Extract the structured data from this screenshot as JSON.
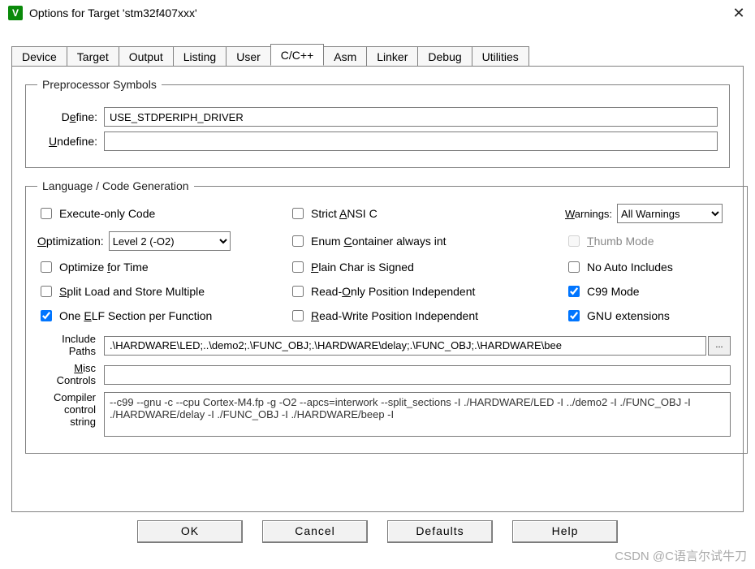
{
  "window": {
    "title": "Options for Target 'stm32f407xxx'",
    "close": "✕",
    "icon_letter": "V"
  },
  "tabs": {
    "items": [
      "Device",
      "Target",
      "Output",
      "Listing",
      "User",
      "C/C++",
      "Asm",
      "Linker",
      "Debug",
      "Utilities"
    ],
    "active": "C/C++"
  },
  "preproc": {
    "legend": "Preprocessor Symbols",
    "define_label_pre": "D",
    "define_label_u": "e",
    "define_label_post": "fine:",
    "define_value": "USE_STDPERIPH_DRIVER",
    "undef_label_pre": "",
    "undef_label_u": "U",
    "undef_label_post": "ndefine:",
    "undef_value": ""
  },
  "lang": {
    "legend": "Language / Code Generation",
    "execute_only": "Execute-only Code",
    "strict_ansi_pre": "Strict ",
    "strict_ansi_u": "A",
    "strict_ansi_post": "NSI C",
    "warnings_pre": "",
    "warnings_u": "W",
    "warnings_post": "arnings:",
    "warnings_value": "All Warnings",
    "optimization_pre": "",
    "optimization_u": "O",
    "optimization_post": "ptimization:",
    "optimization_value": "Level 2 (-O2)",
    "enum_pre": "Enum ",
    "enum_u": "C",
    "enum_post": "ontainer always int",
    "thumb_pre": "",
    "thumb_u": "T",
    "thumb_post": "humb Mode",
    "opt_time_pre": "Optimize ",
    "opt_time_u": "f",
    "opt_time_post": "or Time",
    "plain_pre": "",
    "plain_u": "P",
    "plain_post": "lain Char is Signed",
    "noauto": "No Auto Includes",
    "split_pre": "",
    "split_u": "S",
    "split_post": "plit Load and Store Multiple",
    "ropi_pre": "Read-",
    "ropi_u": "O",
    "ropi_post": "nly Position Independent",
    "c99": "C99 Mode",
    "oneelf_pre": "One ",
    "oneelf_u": "E",
    "oneelf_post": "LF Section per Function",
    "rwpi_pre": "",
    "rwpi_u": "R",
    "rwpi_post": "ead-Write Position Independent",
    "gnu": "GNU extensions",
    "include_label": "Include\nPaths",
    "include_value": ".\\HARDWARE\\LED;..\\demo2;.\\FUNC_OBJ;.\\HARDWARE\\delay;.\\FUNC_OBJ;.\\HARDWARE\\bee",
    "browse": "...",
    "misc_label_pre": "",
    "misc_label_u": "M",
    "misc_label_post": "isc\nControls",
    "misc_value": "",
    "ccs_label": "Compiler\ncontrol\nstring",
    "ccs_value": "--c99 --gnu -c --cpu Cortex-M4.fp -g -O2 --apcs=interwork --split_sections -I ./HARDWARE/LED -I ../demo2 -I ./FUNC_OBJ -I ./HARDWARE/delay -I ./FUNC_OBJ -I ./HARDWARE/beep -I"
  },
  "buttons": {
    "ok": "OK",
    "cancel": "Cancel",
    "defaults": "Defaults",
    "help": "Help"
  },
  "watermark": "CSDN @C语言尔试牛刀"
}
